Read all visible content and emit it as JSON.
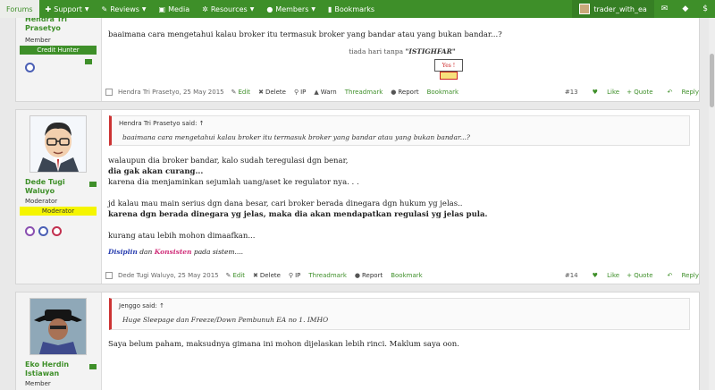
{
  "nav": {
    "items": [
      {
        "label": "Forums",
        "icon": "none",
        "active": true
      },
      {
        "label": "Support",
        "icon": "support-icon",
        "active": false
      },
      {
        "label": "Reviews",
        "icon": "reviews-icon",
        "active": false
      },
      {
        "label": "Media",
        "icon": "media-icon",
        "active": false
      },
      {
        "label": "Resources",
        "icon": "resources-icon",
        "active": false
      },
      {
        "label": "Members",
        "icon": "members-icon",
        "active": false
      },
      {
        "label": "Bookmarks",
        "icon": "bookmarks-icon",
        "active": false
      }
    ],
    "account_name": "trader_with_ea"
  },
  "post13": {
    "author": "Hendra Tri Prasetyo",
    "title": "Member",
    "banner": "Credit Hunter",
    "body": "baaimana cara mengetahui kalau broker itu termasuk broker yang bandar atau yang bukan bandar...?",
    "sig_text": "tiada hari tanpa",
    "sig_em": "\"ISTIGHFAR\"",
    "footer": {
      "meta": "Hendra Tri Prasetyo, 25 May 2015",
      "edit": "Edit",
      "delete": "Delete",
      "ip": "IP",
      "warn": "Warn",
      "threadmark": "Threadmark",
      "report": "Report",
      "bookmark": "Bookmark",
      "num": "#13",
      "like": "Like",
      "quote": "+ Quote",
      "reply": "Reply"
    }
  },
  "post14": {
    "author": "Dede Tugi Waluyo",
    "title": "Moderator",
    "banner": "Moderator",
    "quote_header": "Hendra Tri Prasetyo said: ↑",
    "quote_body": "baaimana cara mengetahui kalau broker itu termasuk broker yang bandar atau yang bukan bandar...?",
    "p1": "walaupun dia broker bandar, kalo sudah teregulasi dgn benar,",
    "p2": "dia gak akan curang...",
    "p3": "karena dia menjaminkan sejumlah uang/aset ke regulator nya. . .",
    "p4": "jd kalau mau main serius dgn dana besar, cari broker berada dinegara dgn hukum yg jelas..",
    "p5": "karena dgn berada dinegara yg jelas, maka dia akan mendapatkan regulasi yg jelas pula.",
    "p6": "kurang atau lebih mohon dimaafkan...",
    "sig_a": "Disiplin",
    "sig_b": "dan",
    "sig_c": "Konsisten",
    "sig_d": "pada sistem....",
    "footer": {
      "meta": "Dede Tugi Waluyo, 25 May 2015",
      "edit": "Edit",
      "delete": "Delete",
      "ip": "IP",
      "threadmark": "Threadmark",
      "report": "Report",
      "bookmark": "Bookmark",
      "num": "#14",
      "like": "Like",
      "quote": "+ Quote",
      "reply": "Reply"
    }
  },
  "post15": {
    "author": "Eko Herdin Istiawan",
    "title": "Member",
    "quote_header": "Jenggo said: ↑",
    "quote_body": "Huge Sleepage dan Freeze/Down Pembunuh EA no 1. IMHO",
    "body": "Saya belum paham, maksudnya gimana ini mohon dijelaskan lebih rinci. Maklum saya oon."
  },
  "colors": {
    "accent": "#3e8f29",
    "moderator_banner": "#f5f500",
    "credit_banner": "#3e8f29"
  }
}
